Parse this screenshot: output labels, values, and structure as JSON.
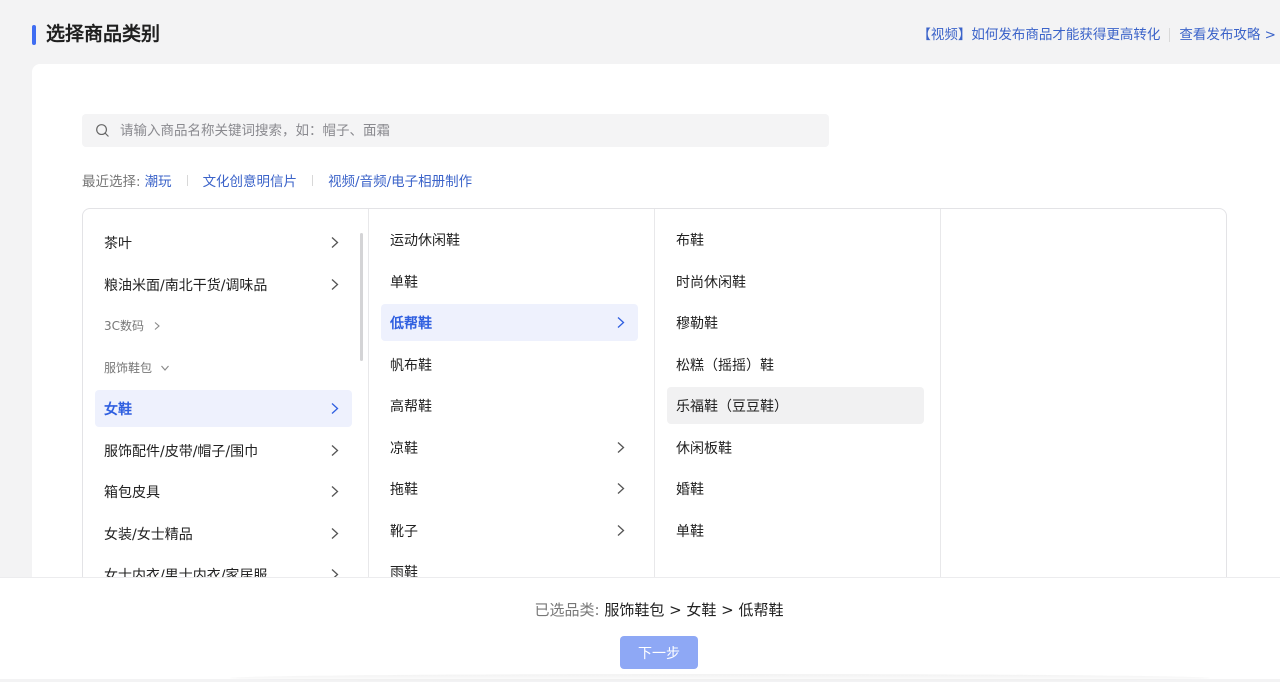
{
  "header": {
    "title": "选择商品类别",
    "video_link": "【视频】如何发布商品才能获得更高转化",
    "guide_link": "查看发布攻略 >"
  },
  "search": {
    "placeholder": "请输入商品名称关键词搜索，如：帽子、面霜",
    "value": ""
  },
  "recent": {
    "label": "最近选择:",
    "items": [
      "潮玩",
      "文化创意明信片",
      "视频/音频/电子相册制作"
    ]
  },
  "columns": {
    "level1": [
      {
        "label": "茶叶",
        "arrow": true
      },
      {
        "label": "粮油米面/南北干货/调味品",
        "arrow": true
      },
      {
        "label": "3C数码",
        "group": true,
        "expanded": false
      },
      {
        "label": "服饰鞋包",
        "group": true,
        "expanded": true
      },
      {
        "label": "女鞋",
        "arrow": true,
        "active": true
      },
      {
        "label": "服饰配件/皮带/帽子/围巾",
        "arrow": true
      },
      {
        "label": "箱包皮具",
        "arrow": true
      },
      {
        "label": "女装/女士精品",
        "arrow": true
      },
      {
        "label": "女士内衣/男士内衣/家居服",
        "arrow": true
      }
    ],
    "level2": [
      {
        "label": "运动休闲鞋",
        "arrow": false
      },
      {
        "label": "单鞋",
        "arrow": false
      },
      {
        "label": "低帮鞋",
        "arrow": true,
        "active": true
      },
      {
        "label": "帆布鞋",
        "arrow": false
      },
      {
        "label": "高帮鞋",
        "arrow": false
      },
      {
        "label": "凉鞋",
        "arrow": true
      },
      {
        "label": "拖鞋",
        "arrow": true
      },
      {
        "label": "靴子",
        "arrow": true
      },
      {
        "label": "雨鞋",
        "arrow": false
      }
    ],
    "level3": [
      {
        "label": "布鞋"
      },
      {
        "label": "时尚休闲鞋"
      },
      {
        "label": "穆勒鞋"
      },
      {
        "label": "松糕（摇摇）鞋"
      },
      {
        "label": "乐福鞋（豆豆鞋）",
        "hover": true
      },
      {
        "label": "休闲板鞋"
      },
      {
        "label": "婚鞋"
      },
      {
        "label": "单鞋"
      }
    ]
  },
  "footer": {
    "selected_label": "已选品类:",
    "selected_path": "服饰鞋包 > 女鞋 > 低帮鞋",
    "next_button": "下一步"
  },
  "colors": {
    "accent": "#3f6df2",
    "link": "#3b63c9",
    "active_bg": "#eef1fd",
    "button_disabled": "#8ea8f5"
  }
}
